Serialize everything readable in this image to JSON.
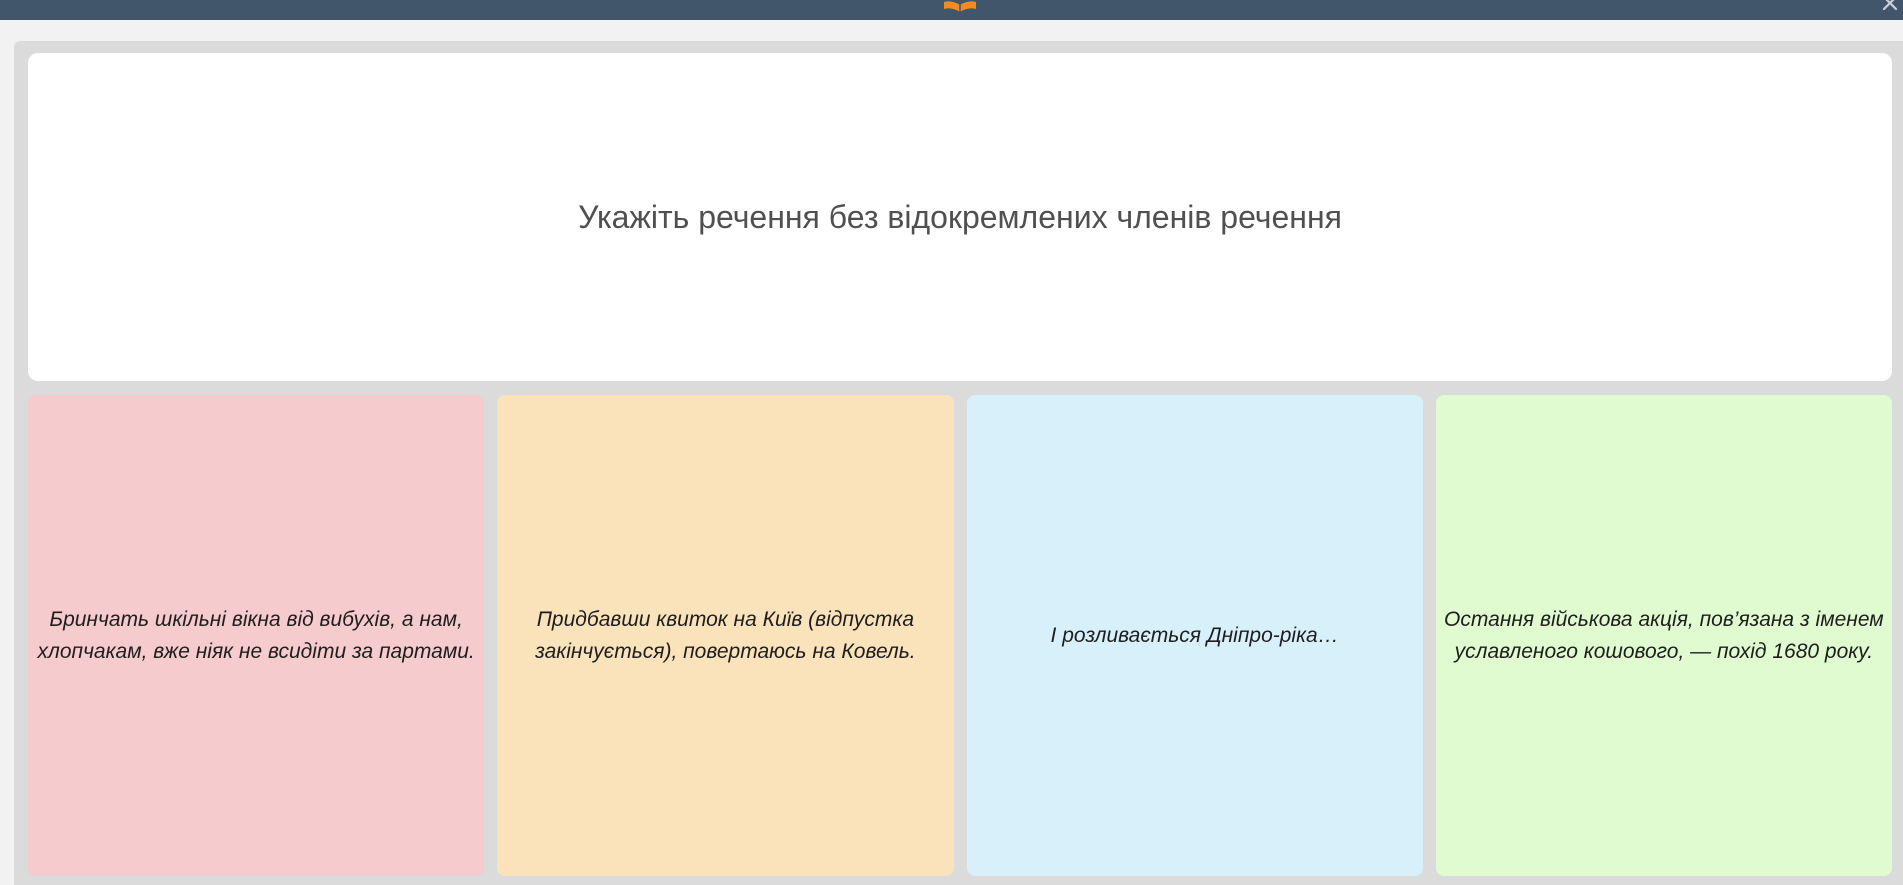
{
  "header": {
    "logo_icon": "open-book-icon",
    "close_icon": "close-icon",
    "bar_color": "#42566b",
    "logo_color": "#f58a1f"
  },
  "question": {
    "text": "Укажіть речення без відокремлених членів речення"
  },
  "answers": [
    {
      "text": "Бринчать шкільні вікна від вибухів, а нам, хлопчакам, вже ніяк не всидіти за партами.",
      "color": "#f6cbcd"
    },
    {
      "text": "Придбавши квиток на Київ (відпустка закінчується), повертаюсь на Ковель.",
      "color": "#fae2bb"
    },
    {
      "text": "І розливається Дніпро-ріка…",
      "color": "#d8f0fa"
    },
    {
      "text": "Остання військова акція, пов’язана з іменем уславленого кошового, — похід 1680 року.",
      "color": "#e0fbcf"
    }
  ]
}
